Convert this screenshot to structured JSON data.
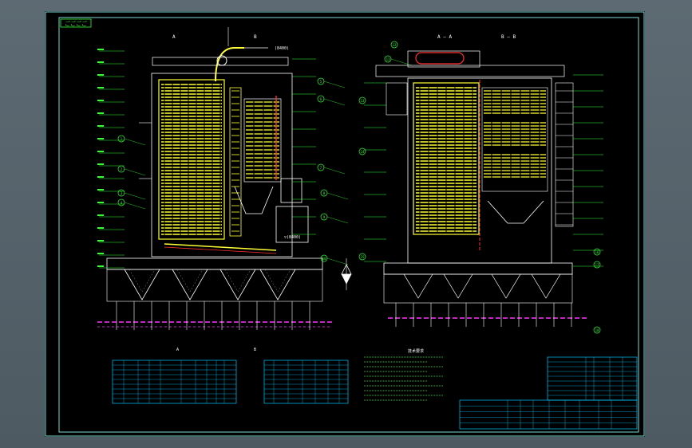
{
  "drawing": {
    "corner_tag": "ごごごご",
    "left_view": {
      "section_label_a": "A",
      "section_label_b": "B",
      "elevation_tag": "(8400)",
      "inline_tag": "▽(8400)",
      "callouts": [
        "1",
        "2",
        "3",
        "4",
        "5",
        "6",
        "7",
        "8",
        "9",
        "10",
        "11"
      ]
    },
    "right_view": {
      "section_label_aa": "A – A",
      "section_label_bb": "B – B",
      "callouts": [
        "12",
        "13",
        "14",
        "15",
        "16",
        "17",
        "18"
      ]
    },
    "symbols": {
      "north_arrow": "north-arrow-icon"
    },
    "table_left_caption": "A",
    "table_mid_caption": "B",
    "notes_title": "技术要求"
  },
  "colors": {
    "sheet_bg": "#000000",
    "frame": "#7fd9d9",
    "wall": "#ffffff",
    "tubes": "#ffff33",
    "pipe_red": "#ff3030",
    "dimension": "#33ff33",
    "foundation": "#ff33ff",
    "table_line": "#00c8ff",
    "callout": "#33ff33",
    "text": "#ffffff"
  }
}
